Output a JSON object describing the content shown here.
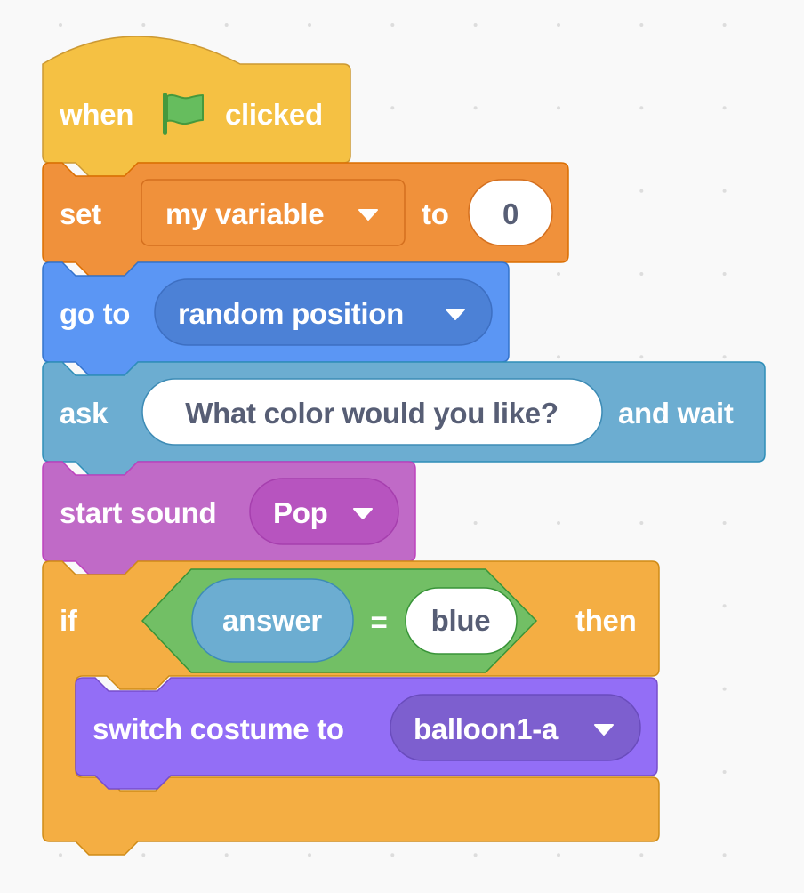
{
  "workspace": {
    "background": "#f9f9f9",
    "grid_dot_color": "#dddddd"
  },
  "script": {
    "hat": {
      "category": "events",
      "color": "#f5c143",
      "border": "#cc9933",
      "label_when": "when",
      "icon": "green-flag-icon",
      "label_clicked": "clicked"
    },
    "set_variable": {
      "category": "variables",
      "color": "#f0913b",
      "border": "#db6e00",
      "label_set": "set",
      "variable_dropdown": "my variable",
      "label_to": "to",
      "value": "0"
    },
    "go_to": {
      "category": "motion",
      "color": "#5b96f4",
      "border": "#3373cc",
      "label": "go to",
      "target_dropdown": "random position"
    },
    "ask": {
      "category": "sensing",
      "color": "#6cadd1",
      "border": "#2e8eb8",
      "label_ask": "ask",
      "question": "What color would you like?",
      "label_wait": "and wait"
    },
    "start_sound": {
      "category": "sound",
      "color": "#c06ac7",
      "border": "#bd42bd",
      "label": "start sound",
      "sound_dropdown": "Pop"
    },
    "if_then": {
      "category": "control",
      "color": "#f4ae43",
      "border": "#cf8b17",
      "label_if": "if",
      "label_then": "then",
      "condition": {
        "category": "operators",
        "color": "#72bf65",
        "border": "#389438",
        "left_reporter": "answer",
        "operator": "=",
        "right_value": "blue"
      },
      "body": {
        "switch_costume": {
          "category": "looks",
          "color": "#936ef6",
          "border": "#774dcb",
          "label": "switch costume to",
          "costume_dropdown": "balloon1-a"
        }
      }
    }
  }
}
